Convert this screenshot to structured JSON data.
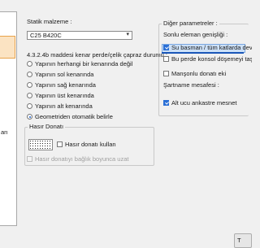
{
  "static_material": {
    "label": "Statik malzeme :",
    "value": "C25 B420C"
  },
  "edge_rules": {
    "title": "4.3.2.4b maddesi kenar perde/çelik çapraz durumu :",
    "options": [
      {
        "label": "Yapının herhangi bir kenarında değil",
        "checked": false
      },
      {
        "label": "Yapının sol kenarında",
        "checked": false
      },
      {
        "label": "Yapının sağ kenarında",
        "checked": false
      },
      {
        "label": "Yapının üst kenarında",
        "checked": false
      },
      {
        "label": "Yapının alt kenarında",
        "checked": false
      },
      {
        "label": "Geometriden otomatik belirle",
        "checked": true
      }
    ]
  },
  "hasir": {
    "title": "Hasır Donatı",
    "use_label": "Hasır donatı kullan",
    "extend_label": "Hasır donatıyı bağlık boyunca uzat"
  },
  "other_params": {
    "title": "Diğer parametreler :",
    "end_level_label": "Sonlu eleman genişliği :",
    "opt1": "Su basman / tüm katlarda deva",
    "opt2": "Bu perde konsol döşemeyi taşıy",
    "mansonlu_label": "Manşonlu donatı eki",
    "sartname_label": "Şartname mesafesi :",
    "alt_ucu_label": "Alt ucu ankastre mesnet"
  },
  "left_panel": {
    "fragment": "arı"
  },
  "bottom_button": {
    "label": "T"
  }
}
